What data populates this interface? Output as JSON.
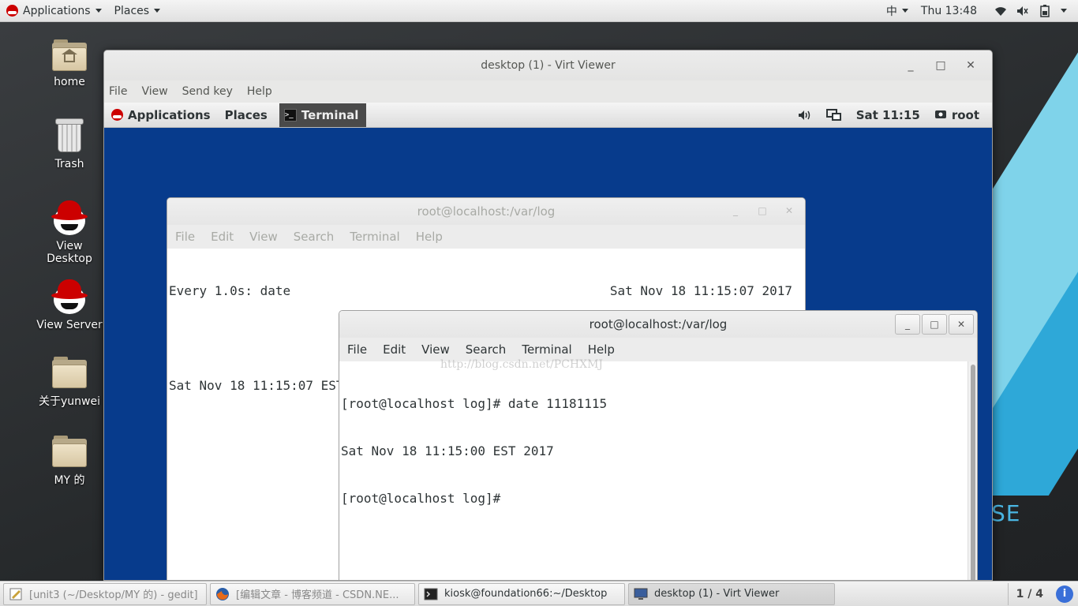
{
  "top_bar": {
    "applications": "Applications",
    "places": "Places",
    "input_method": "中",
    "clock": "Thu 13:48"
  },
  "desktop_icons": [
    {
      "label": "home",
      "icon": "home-folder-icon"
    },
    {
      "label": "Trash",
      "icon": "trash-icon"
    },
    {
      "label": "View Desktop",
      "icon": "redhat-icon"
    },
    {
      "label": "View Server",
      "icon": "redhat-icon"
    },
    {
      "label": "关于yunwei",
      "icon": "folder-icon"
    },
    {
      "label": "MY 的",
      "icon": "folder-icon"
    }
  ],
  "background_text": "SE",
  "virt_viewer": {
    "title": "desktop (1) - Virt Viewer",
    "menu": [
      "File",
      "View",
      "Send key",
      "Help"
    ],
    "controls": {
      "minimize": "_",
      "maximize": "□",
      "close": "✕"
    }
  },
  "guest": {
    "top_bar": {
      "applications": "Applications",
      "places": "Places",
      "terminal": "Terminal",
      "clock": "Sat 11:15",
      "user": "root"
    },
    "back_terminal": {
      "title": "root@localhost:/var/log",
      "menu": [
        "File",
        "Edit",
        "View",
        "Search",
        "Terminal",
        "Help"
      ],
      "line1_left": "Every 1.0s: date",
      "line1_right": "Sat Nov 18 11:15:07 2017",
      "line2": "Sat Nov 18 11:15:07 EST 2017"
    },
    "front_terminal": {
      "title": "root@localhost:/var/log",
      "menu": [
        "File",
        "Edit",
        "View",
        "Search",
        "Terminal",
        "Help"
      ],
      "lines": [
        "[root@localhost log]# date 11181115",
        "Sat Nov 18 11:15:00 EST 2017",
        "[root@localhost log]# "
      ],
      "watermark": "http://blog.csdn.net/PCHXMJ"
    }
  },
  "taskbar": {
    "tasks": [
      {
        "label": "[unit3 (~/Desktop/MY 的) - gedit]",
        "icon": "gedit-icon"
      },
      {
        "label": "[编辑文章 - 博客频道 - CSDN.NE...",
        "icon": "firefox-icon"
      },
      {
        "label": "kiosk@foundation66:~/Desktop",
        "icon": "terminal-icon"
      },
      {
        "label": "desktop (1) - Virt Viewer",
        "icon": "virt-viewer-icon"
      }
    ],
    "workspace": "1 / 4",
    "info": "i"
  }
}
